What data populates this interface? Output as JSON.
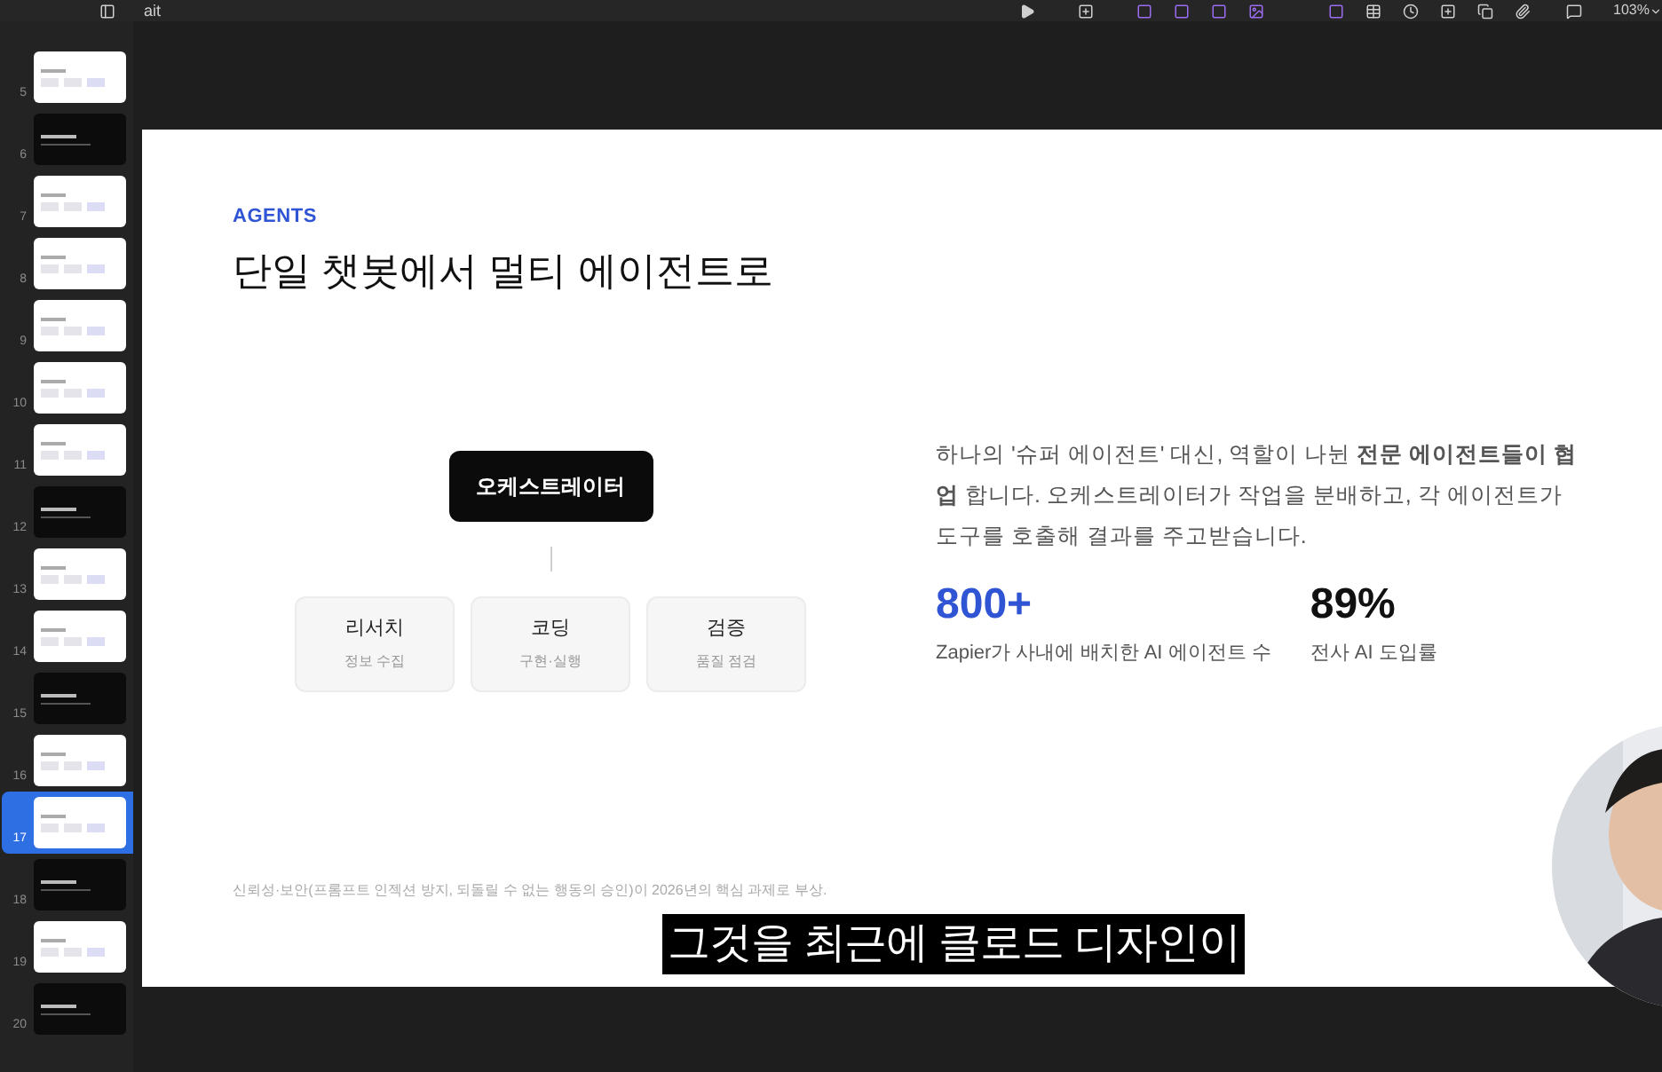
{
  "toolbar": {
    "title": "ait",
    "zoom": "103%"
  },
  "slides": [
    {
      "number": "5",
      "kind": "light",
      "selected": false
    },
    {
      "number": "6",
      "kind": "dark",
      "selected": false
    },
    {
      "number": "7",
      "kind": "light",
      "selected": false
    },
    {
      "number": "8",
      "kind": "light",
      "selected": false
    },
    {
      "number": "9",
      "kind": "light",
      "selected": false
    },
    {
      "number": "10",
      "kind": "light",
      "selected": false
    },
    {
      "number": "11",
      "kind": "light",
      "selected": false
    },
    {
      "number": "12",
      "kind": "dark",
      "selected": false
    },
    {
      "number": "13",
      "kind": "light",
      "selected": false
    },
    {
      "number": "14",
      "kind": "light",
      "selected": false
    },
    {
      "number": "15",
      "kind": "dark",
      "selected": false
    },
    {
      "number": "16",
      "kind": "light",
      "selected": false
    },
    {
      "number": "17",
      "kind": "light",
      "selected": true
    },
    {
      "number": "18",
      "kind": "dark",
      "selected": false
    },
    {
      "number": "19",
      "kind": "light",
      "selected": false
    },
    {
      "number": "20",
      "kind": "dark",
      "selected": false
    }
  ],
  "slide": {
    "eyebrow": "AGENTS",
    "title": "단일 챗봇에서 멀티 에이전트로",
    "orchestrator": "오케스트레이터",
    "agents": [
      {
        "name": "리서치",
        "role": "정보 수집"
      },
      {
        "name": "코딩",
        "role": "구현·실행"
      },
      {
        "name": "검증",
        "role": "품질 점검"
      }
    ],
    "description": "하나의 '슈퍼 에이전트' 대신, 역할이 나뉜 **전문 에이전트들이 협업** 합니다. 오케스트레이터가 작업을 분배하고, 각 에이전트가 도구를 호출해 결과를 주고받습니다.",
    "stats": [
      {
        "value": "800+",
        "label": "Zapier가 사내에 배치한 AI 에이전트 수",
        "color": "#2f55d4"
      },
      {
        "value": "89%",
        "label": "전사 AI 도입률",
        "color": "#111111"
      }
    ],
    "footnote": "신뢰성·보안(프롬프트 인젝션 방지, 되돌릴 수 없는 행동의 승인)이 2026년의 핵심 과제로 부상."
  },
  "caption": "그것을 최근에 클로드 디자인이"
}
